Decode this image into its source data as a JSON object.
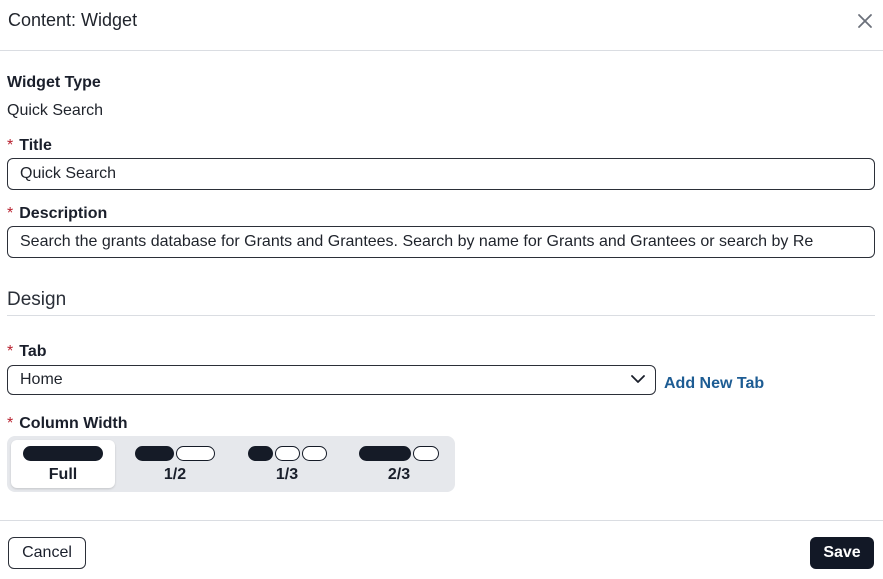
{
  "dialog": {
    "title": "Content: Widget",
    "close_icon": "close-icon"
  },
  "widget_type": {
    "label": "Widget Type",
    "value": "Quick Search"
  },
  "title_field": {
    "required_mark": "*",
    "label": "Title",
    "value": "Quick Search"
  },
  "description_field": {
    "required_mark": "*",
    "label": "Description",
    "value": "Search the grants database for Grants and Grantees.  Search by name for Grants and Grantees or search by Re"
  },
  "design": {
    "section_title": "Design",
    "tab": {
      "required_mark": "*",
      "label": "Tab",
      "selected": "Home",
      "chevron_icon": "chevron-down-icon",
      "add_link": "Add New Tab"
    },
    "column_width": {
      "required_mark": "*",
      "label": "Column Width",
      "selected": "Full",
      "options": [
        {
          "label": "Full",
          "filled_fraction": 1.0
        },
        {
          "label": "1/2",
          "filled_fraction": 0.5
        },
        {
          "label": "1/3",
          "filled_fraction": 0.333
        },
        {
          "label": "2/3",
          "filled_fraction": 0.667
        }
      ]
    }
  },
  "footer": {
    "cancel_label": "Cancel",
    "save_label": "Save"
  },
  "colors": {
    "primary_dark": "#121826",
    "link": "#1d5c93",
    "required": "#b8202e",
    "border": "#2b2f38"
  }
}
